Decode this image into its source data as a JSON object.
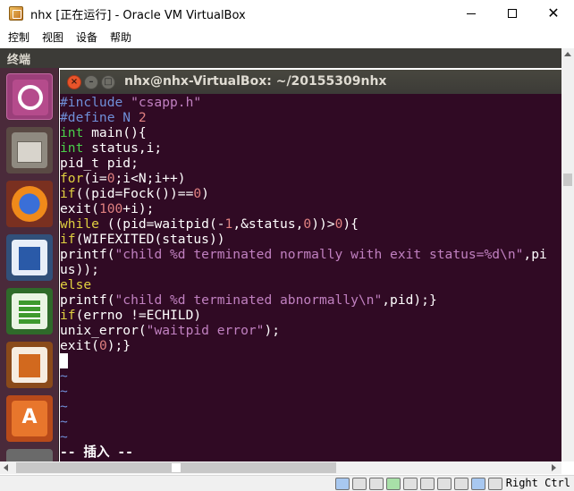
{
  "window": {
    "title": "nhx [正在运行] - Oracle VM VirtualBox"
  },
  "menubar": {
    "items": [
      "控制",
      "视图",
      "设备",
      "帮助"
    ]
  },
  "ubuntu_bar": {
    "label": "终端"
  },
  "launcher": {
    "items": [
      "ubuntu-dash",
      "files",
      "firefox",
      "libreoffice-writer",
      "libreoffice-calc",
      "libreoffice-impress",
      "ubuntu-software",
      "help"
    ]
  },
  "terminal": {
    "title": "nhx@nhx-VirtualBox: ~/20155309nhx",
    "lines": [
      [
        [
          "t-pre",
          "#include "
        ],
        [
          "t-str",
          "\"csapp.h\""
        ]
      ],
      [
        [
          "t-pre",
          "#define N "
        ],
        [
          "t-num",
          "2"
        ]
      ],
      [
        [
          "t-type",
          "int"
        ],
        [
          "t-plain",
          " main(){"
        ]
      ],
      [
        [
          "t-type",
          "int"
        ],
        [
          "t-plain",
          " status,i;"
        ]
      ],
      [
        [
          "t-plain",
          "pid_t pid;"
        ]
      ],
      [
        [
          "t-kw",
          "for"
        ],
        [
          "t-plain",
          "(i="
        ],
        [
          "t-num",
          "0"
        ],
        [
          "t-plain",
          ";i<N;i++)"
        ]
      ],
      [
        [
          "t-kw",
          "if"
        ],
        [
          "t-plain",
          "((pid=Fock())=="
        ],
        [
          "t-num",
          "0"
        ],
        [
          "t-plain",
          ")"
        ]
      ],
      [
        [
          "t-plain",
          "exit("
        ],
        [
          "t-num",
          "100"
        ],
        [
          "t-plain",
          "+i);"
        ]
      ],
      [
        [
          "t-kw",
          "while"
        ],
        [
          "t-plain",
          " ((pid=waitpid(-"
        ],
        [
          "t-num",
          "1"
        ],
        [
          "t-plain",
          ",&status,"
        ],
        [
          "t-num",
          "0"
        ],
        [
          "t-plain",
          "))>"
        ],
        [
          "t-num",
          "0"
        ],
        [
          "t-plain",
          "){"
        ]
      ],
      [
        [
          "t-kw",
          "if"
        ],
        [
          "t-plain",
          "(WIFEXITED(status))"
        ]
      ],
      [
        [
          "t-plain",
          "printf("
        ],
        [
          "t-str",
          "\"child %d terminated normally with exit status=%d\\n\""
        ],
        [
          "t-plain",
          ",pi"
        ]
      ],
      [
        [
          "t-plain",
          "us));"
        ]
      ],
      [
        [
          "t-kw",
          "else"
        ]
      ],
      [
        [
          "t-plain",
          "printf("
        ],
        [
          "t-str",
          "\"child %d terminated abnormally\\n\""
        ],
        [
          "t-plain",
          ",pid);}"
        ]
      ],
      [
        [
          "t-kw",
          "if"
        ],
        [
          "t-plain",
          "(errno !=ECHILD)"
        ]
      ],
      [
        [
          "t-plain",
          "unix_error("
        ],
        [
          "t-str",
          "\"waitpid error\""
        ],
        [
          "t-plain",
          ");"
        ]
      ],
      [
        [
          "t-plain",
          "exit("
        ],
        [
          "t-num",
          "0"
        ],
        [
          "t-plain",
          ");}"
        ]
      ]
    ],
    "tildes": [
      "~",
      "~",
      "~",
      "~",
      "~"
    ],
    "mode_line": "-- 插入 --"
  },
  "statusbar": {
    "host_key": "Right Ctrl"
  }
}
